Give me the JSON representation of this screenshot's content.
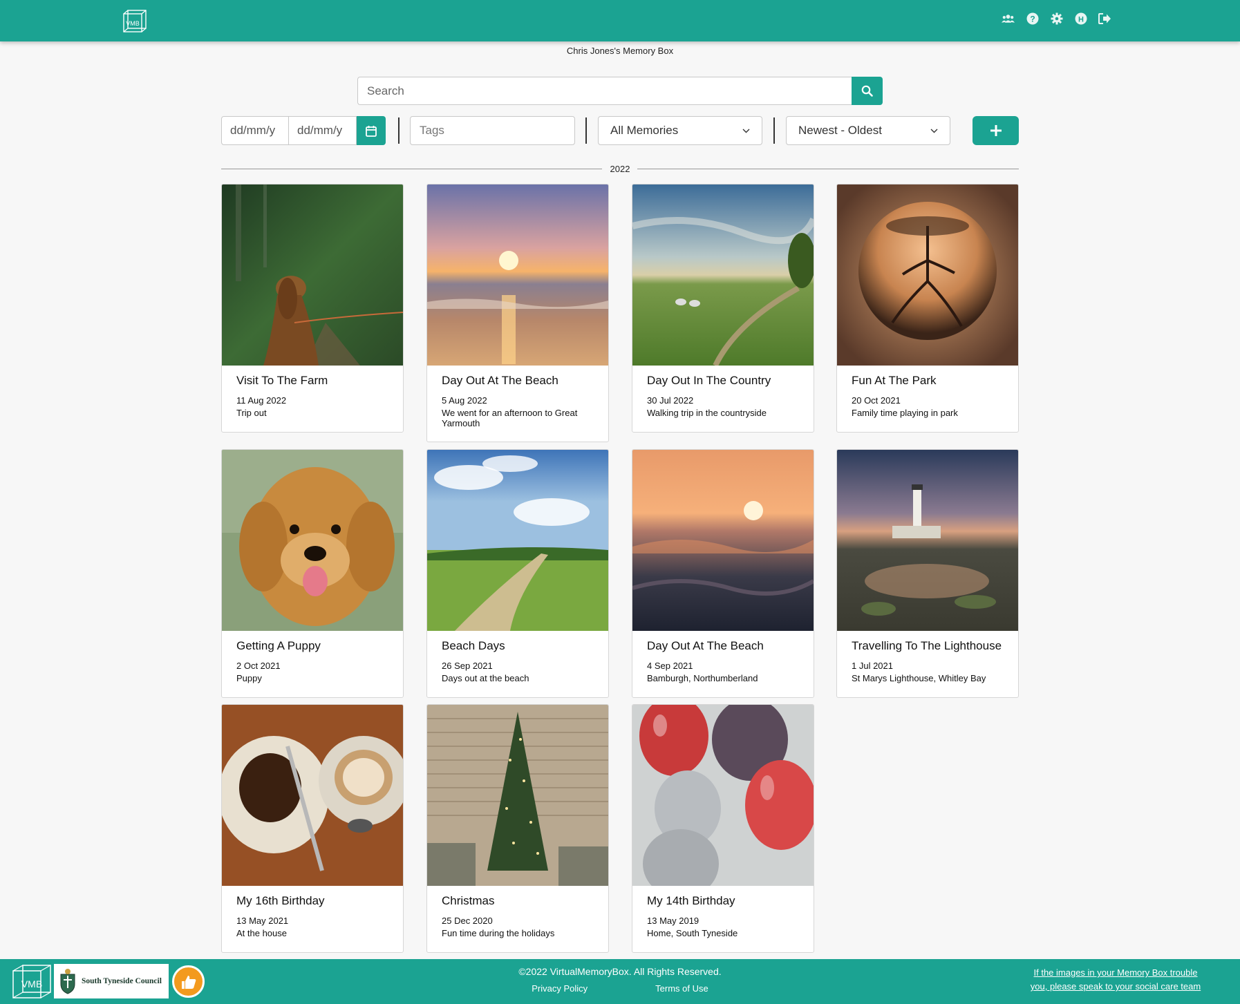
{
  "header": {
    "logo_text": "VMB",
    "icons": [
      "users-icon",
      "help-icon",
      "settings-icon",
      "h-icon",
      "logout-icon"
    ]
  },
  "box_title": "Chris Jones's Memory Box",
  "search": {
    "placeholder": "Search"
  },
  "filters": {
    "date_from_placeholder": "dd/mm/y",
    "date_to_placeholder": "dd/mm/y",
    "tags_placeholder": "Tags",
    "memory_type": "All Memories",
    "sort": "Newest - Oldest",
    "add_icon": "plus-icon"
  },
  "year_label": "2022",
  "memories": [
    {
      "title": "Visit To The Farm",
      "date": "11 Aug 2022",
      "desc": "Trip out"
    },
    {
      "title": "Day Out At The Beach",
      "date": "5 Aug 2022",
      "desc": "We went for an afternoon to Great Yarmouth"
    },
    {
      "title": "Day Out In The Country",
      "date": "30 Jul 2022",
      "desc": "Walking trip in the countryside"
    },
    {
      "title": "Fun At The Park",
      "date": "20 Oct 2021",
      "desc": "Family time playing in park"
    },
    {
      "title": "Getting A Puppy",
      "date": "2 Oct 2021",
      "desc": "Puppy"
    },
    {
      "title": "Beach Days",
      "date": "26 Sep 2021",
      "desc": "Days out at the beach"
    },
    {
      "title": "Day Out At The Beach",
      "date": "4 Sep 2021",
      "desc": "Bamburgh, Northumberland"
    },
    {
      "title": "Travelling To The Lighthouse",
      "date": "1 Jul 2021",
      "desc": "St Marys Lighthouse, Whitley Bay"
    },
    {
      "title": "My 16th Birthday",
      "date": "13 May 2021",
      "desc": "At the house"
    },
    {
      "title": "Christmas",
      "date": "25 Dec 2020",
      "desc": "Fun time during the holidays"
    },
    {
      "title": "My 14th Birthday",
      "date": "13 May 2019",
      "desc": "Home, South Tyneside"
    }
  ],
  "footer": {
    "logo_text": "VMB",
    "council_name": "South Tyneside Council",
    "copyright": "©2022 VirtualMemoryBox. All Rights Reserved.",
    "privacy": "Privacy Policy",
    "terms": "Terms of Use",
    "note": "If the images in your Memory Box trouble you, please speak to your social care team"
  },
  "colors": {
    "accent": "#1ba392",
    "badge": "#f39a1e"
  }
}
